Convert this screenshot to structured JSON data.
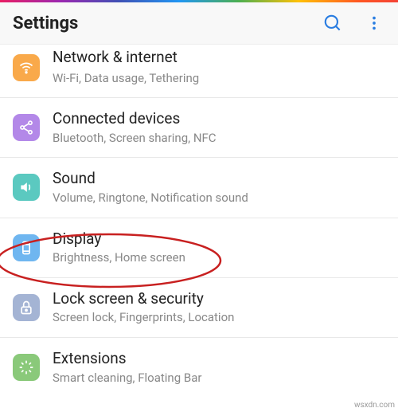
{
  "header": {
    "title": "Settings"
  },
  "items": [
    {
      "title": "Network & internet",
      "sub": "Wi-Fi, Data usage, Tethering"
    },
    {
      "title": "Connected devices",
      "sub": "Bluetooth, Screen sharing, NFC"
    },
    {
      "title": "Sound",
      "sub": "Volume, Ringtone, Notification sound"
    },
    {
      "title": "Display",
      "sub": "Brightness, Home screen"
    },
    {
      "title": "Lock screen & security",
      "sub": "Screen lock, Fingerprints, Location"
    },
    {
      "title": "Extensions",
      "sub": "Smart cleaning, Floating Bar"
    }
  ],
  "watermark": "wsxdn.com"
}
